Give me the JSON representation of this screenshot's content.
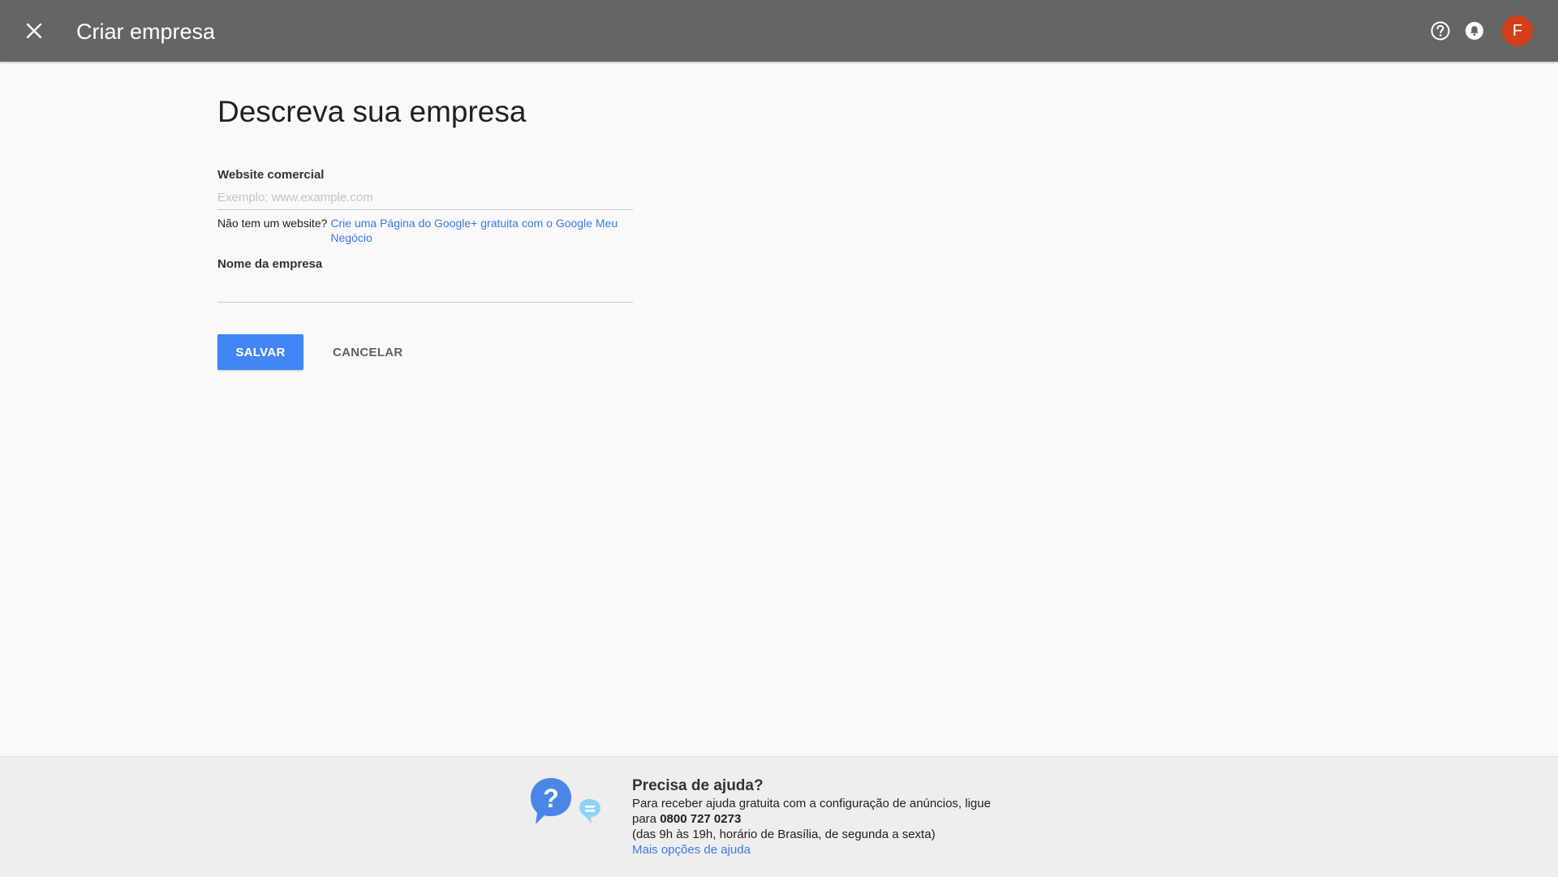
{
  "header": {
    "title": "Criar empresa",
    "avatar_initial": "F",
    "avatar_color": "#d23f18",
    "close_icon": "close-icon",
    "help_icon": "help-circle-icon",
    "notifications_icon": "bell-icon"
  },
  "form": {
    "title": "Descreva sua empresa",
    "website": {
      "label": "Website comercial",
      "placeholder": "Exemplo: www.example.com",
      "value": ""
    },
    "no_website_text": "Não tem um website?",
    "no_website_link": "Crie uma Página do Google+ gratuita com o Google Meu Negócio",
    "business_name": {
      "label": "Nome da empresa",
      "value": ""
    },
    "save_label": "SALVAR",
    "cancel_label": "CANCELAR",
    "accent_color": "#4285f4"
  },
  "footer": {
    "heading": "Precisa de ajuda?",
    "line1": "Para receber ajuda gratuita com a configuração de anúncios, ligue",
    "line2_prefix": "para",
    "phone": "0800 727 0273",
    "line3": "(das 9h às 19h, horário de Brasília, de segunda a sexta)",
    "link": "Mais opções de ajuda",
    "illustration_icon": "help-chat-bubbles-icon"
  }
}
